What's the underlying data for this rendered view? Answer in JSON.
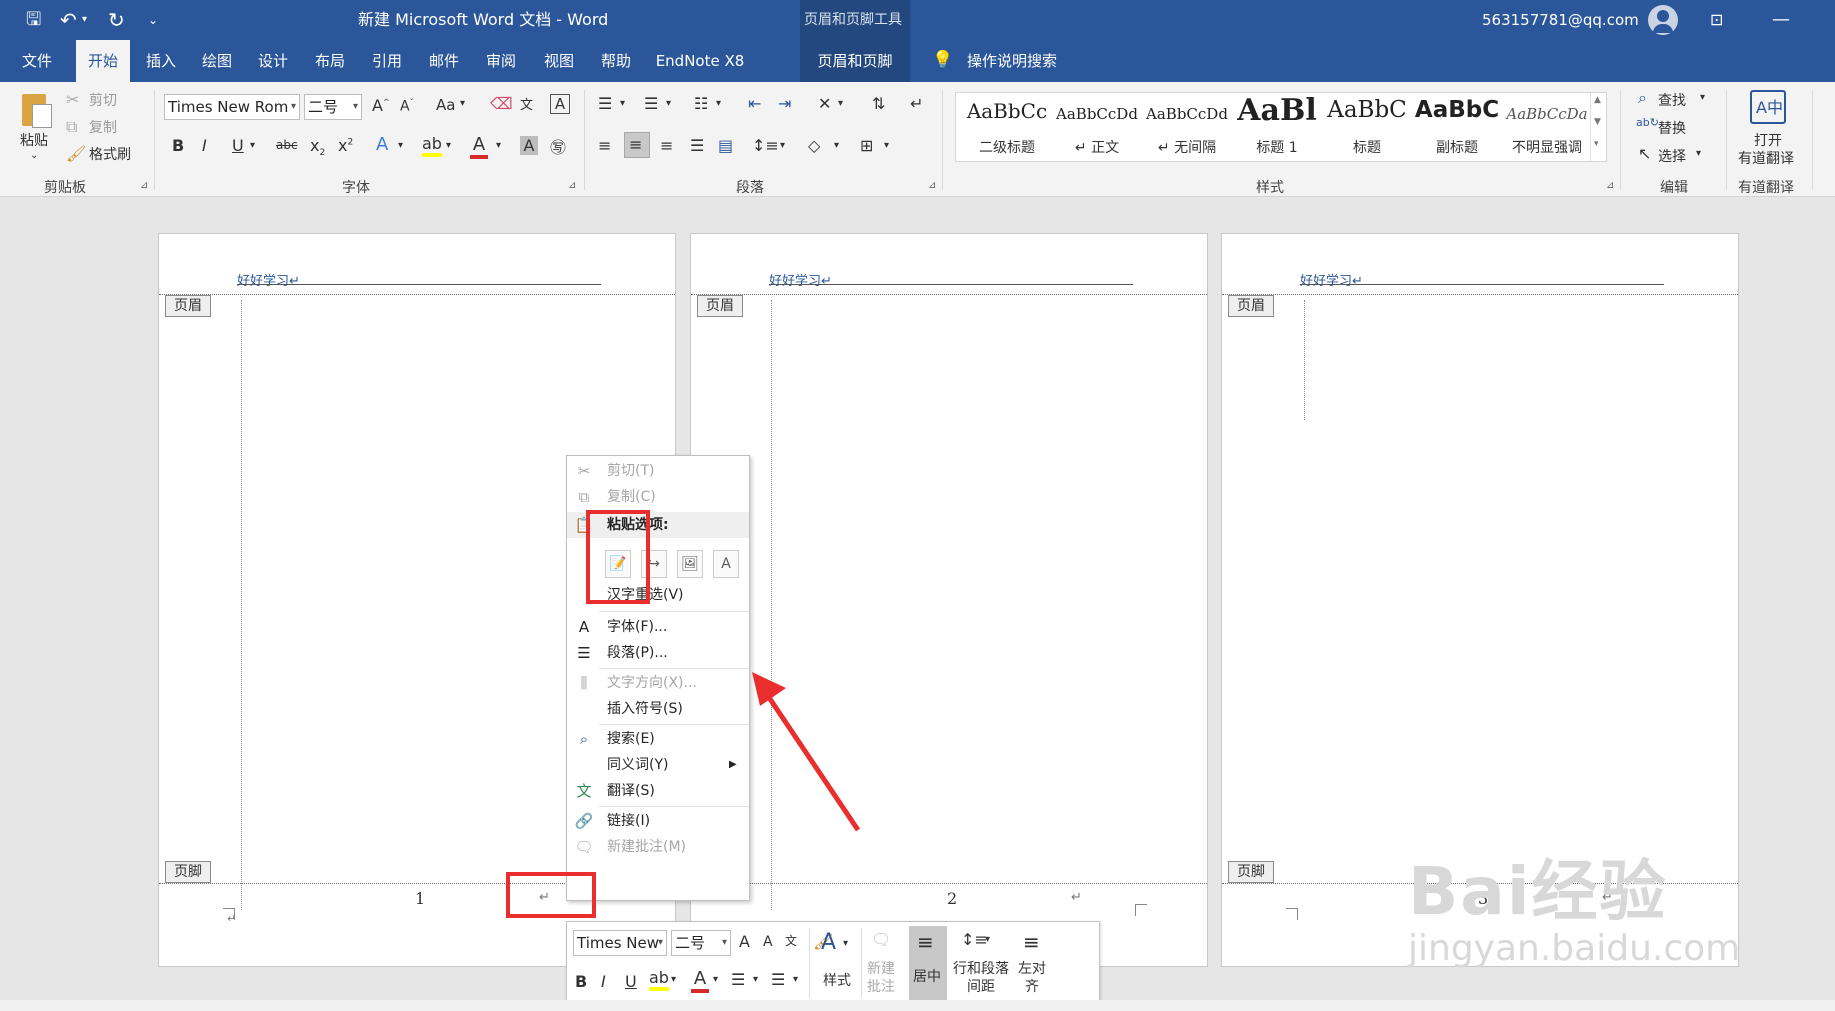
{
  "titlebar": {
    "title": "新建 Microsoft Word 文档 - Word",
    "context_tools": "页眉和页脚工具",
    "user": "563157781@qq.com"
  },
  "menu": {
    "tabs": [
      "文件",
      "开始",
      "插入",
      "绘图",
      "设计",
      "布局",
      "引用",
      "邮件",
      "审阅",
      "视图",
      "帮助",
      "EndNote X8"
    ],
    "context_tab": "页眉和页脚",
    "tell_me": "操作说明搜索"
  },
  "ribbon": {
    "clipboard": {
      "paste": "粘贴",
      "cut": "剪切",
      "copy": "复制",
      "format_painter": "格式刷",
      "label": "剪贴板"
    },
    "font": {
      "name": "Times New Rom",
      "size": "二号",
      "label": "字体",
      "case": "Aa"
    },
    "paragraph": {
      "label": "段落"
    },
    "styles": {
      "label": "样式",
      "items": [
        {
          "preview": "AaBbCc",
          "name": "二级标题"
        },
        {
          "preview": "AaBbCcDd",
          "name": "↵ 正文"
        },
        {
          "preview": "AaBbCcDd",
          "name": "↵ 无间隔"
        },
        {
          "preview": "AaBl",
          "name": "标题 1"
        },
        {
          "preview": "AaBbC",
          "name": "标题"
        },
        {
          "preview": "AaBbC",
          "name": "副标题"
        },
        {
          "preview": "AaBbCcDa",
          "name": "不明显强调"
        }
      ]
    },
    "editing": {
      "find": "查找",
      "replace": "替换",
      "select": "选择",
      "label": "编辑"
    },
    "youdao": {
      "open": "打开",
      "translate": "有道翻译",
      "label": "有道翻译"
    }
  },
  "pages": [
    {
      "header_text": "好好学习↵",
      "page_number": "1"
    },
    {
      "header_text": "好好学习↵",
      "page_number": "2"
    },
    {
      "header_text": "好好学习↵",
      "page_number": "3"
    }
  ],
  "tags": {
    "header": "页眉",
    "footer": "页脚"
  },
  "context_menu": {
    "cut": "剪切(T)",
    "copy": "复制(C)",
    "paste_options": "粘贴选项:",
    "hanzi_reselect": "汉字重选(V)",
    "font": "字体(F)...",
    "paragraph": "段落(P)...",
    "text_direction": "文字方向(X)...",
    "insert_symbol": "插入符号(S)",
    "search": "搜索(E)",
    "synonyms": "同义词(Y)",
    "translate": "翻译(S)",
    "link": "链接(I)",
    "new_comment": "新建批注(M)"
  },
  "mini_toolbar": {
    "font": "Times New",
    "size": "二号",
    "styles": "样式",
    "new_comment": "新建批注",
    "center": "居中",
    "line_spacing": "行和段落间距",
    "align_left": "左对齐"
  },
  "watermark": {
    "logo": "Bai经验",
    "url": "jingyan.baidu.com"
  },
  "colors": {
    "brand": "#2b579a",
    "highlight_red": "#ea2e2e"
  }
}
